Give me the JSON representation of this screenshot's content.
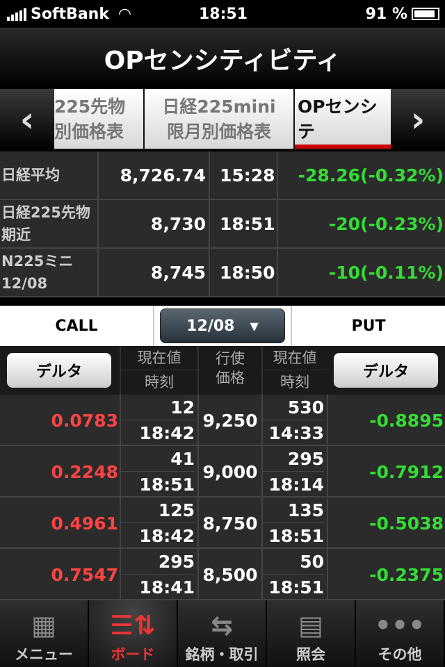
{
  "status": {
    "carrier": "SoftBank",
    "time": "18:51",
    "battery": "91 %"
  },
  "title": "OPセンシティビティ",
  "tabs": [
    {
      "label1": "225先物",
      "label2": "別価格表"
    },
    {
      "label1": "日経225mini",
      "label2": "限月別価格表"
    },
    {
      "label1": "OPセンシテ",
      "label2": "ティ",
      "active": true
    }
  ],
  "indices": [
    {
      "name": "日経平均",
      "value": "8,726.74",
      "time": "15:28",
      "change": "-28.26(-0.32%)"
    },
    {
      "name": "日経225先物期近",
      "value": "8,730",
      "time": "18:51",
      "change": "-20(-0.23%)"
    },
    {
      "name": "N225ミニ12/08",
      "value": "8,745",
      "time": "18:50",
      "change": "-10(-0.11%)"
    }
  ],
  "options_header": {
    "call": "CALL",
    "put": "PUT",
    "month": "12/08",
    "delta_button": "デルタ",
    "price": "現在値",
    "time": "時刻",
    "strike1": "行使",
    "strike2": "価格"
  },
  "options": [
    {
      "call_delta": "0.0783",
      "call_price": "12",
      "call_time": "18:42",
      "strike": "9,250",
      "put_price": "530",
      "put_time": "14:33",
      "put_delta": "-0.8895"
    },
    {
      "call_delta": "0.2248",
      "call_price": "41",
      "call_time": "18:51",
      "strike": "9,000",
      "put_price": "295",
      "put_time": "18:14",
      "put_delta": "-0.7912"
    },
    {
      "call_delta": "0.4961",
      "call_price": "125",
      "call_time": "18:42",
      "strike": "8,750",
      "put_price": "135",
      "put_time": "18:51",
      "put_delta": "-0.5038"
    },
    {
      "call_delta": "0.7547",
      "call_price": "295",
      "call_time": "18:41",
      "strike": "8,500",
      "put_price": "50",
      "put_time": "18:51",
      "put_delta": "-0.2375"
    }
  ],
  "tabbar": [
    {
      "label": "メニュー",
      "icon": "grid-icon"
    },
    {
      "label": "ボード",
      "icon": "board-icon",
      "active": true
    },
    {
      "label": "銘柄・取引",
      "icon": "exchange-icon"
    },
    {
      "label": "照会",
      "icon": "card-icon"
    },
    {
      "label": "その他",
      "icon": "more-icon"
    }
  ],
  "colors": {
    "up": "#33dd33",
    "down": "#ff4444",
    "accent": "#cc0000"
  }
}
